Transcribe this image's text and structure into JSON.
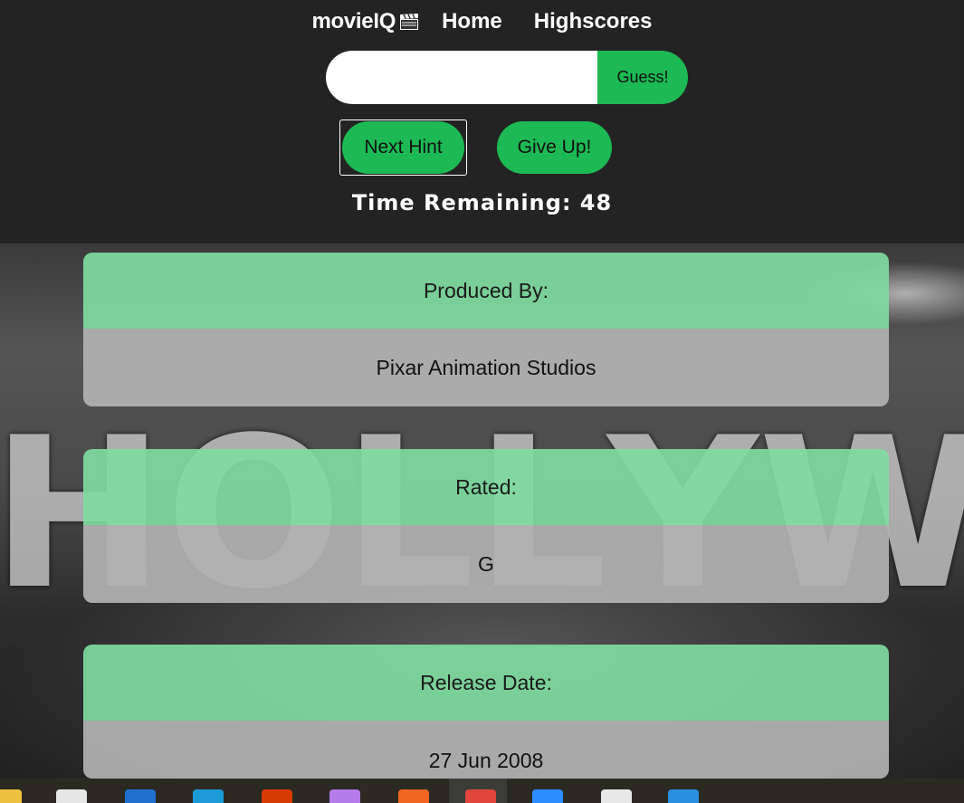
{
  "header": {
    "brand": "movieIQ",
    "brand_icon": "clapperboard-icon",
    "nav": [
      {
        "label": "Home"
      },
      {
        "label": "Highscores"
      }
    ],
    "guess": {
      "input_value": "",
      "input_placeholder": "",
      "button_label": "Guess!"
    },
    "next_hint_label": "Next Hint",
    "give_up_label": "Give Up!",
    "timer_label": "Time Remaining: 48"
  },
  "hints": [
    {
      "title": "Produced By:",
      "value": "Pixar Animation Studios"
    },
    {
      "title": "Rated:",
      "value": "G"
    },
    {
      "title": "Release Date:",
      "value": "27 Jun 2008"
    }
  ],
  "colors": {
    "accent": "#1db954",
    "header_bg": "#232323",
    "card_title_bg": "#7fdb9f",
    "card_body_bg": "#b2b2b2"
  },
  "taskbar": {
    "icons": [
      {
        "name": "file-explorer-icon",
        "color": "#f0c040"
      },
      {
        "name": "store-icon",
        "color": "#e6e6e6"
      },
      {
        "name": "mail-icon",
        "color": "#1f6fd0"
      },
      {
        "name": "app-icon",
        "color": "#1a9bd8"
      },
      {
        "name": "office-icon",
        "color": "#d83b01"
      },
      {
        "name": "messenger-icon",
        "color": "#b57be8"
      },
      {
        "name": "origin-icon",
        "color": "#f26522"
      },
      {
        "name": "chrome-icon",
        "color": "#e0463c"
      },
      {
        "name": "zoom-icon",
        "color": "#2d8cff"
      },
      {
        "name": "slack-icon",
        "color": "#e8e8e8"
      },
      {
        "name": "vscode-icon",
        "color": "#2b8fe0"
      }
    ]
  }
}
